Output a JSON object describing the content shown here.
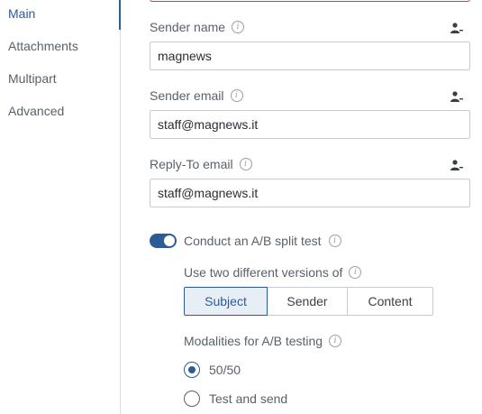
{
  "sidebar": {
    "items": [
      {
        "label": "Main",
        "active": true
      },
      {
        "label": "Attachments",
        "active": false
      },
      {
        "label": "Multipart",
        "active": false
      },
      {
        "label": "Advanced",
        "active": false
      }
    ]
  },
  "form": {
    "sender_name": {
      "label": "Sender name",
      "value": "magnews"
    },
    "sender_email": {
      "label": "Sender email",
      "value": "staff@magnews.it"
    },
    "reply_to": {
      "label": "Reply-To email",
      "value": "staff@magnews.it"
    }
  },
  "ab_test": {
    "toggle_label": "Conduct an A/B split test",
    "enabled": true,
    "versions_label": "Use two different versions of",
    "options": [
      "Subject",
      "Sender",
      "Content"
    ],
    "selected_option": "Subject",
    "modalities_label": "Modalities for A/B testing",
    "modalities": [
      "50/50",
      "Test and send"
    ],
    "selected_modality": "50/50"
  },
  "colors": {
    "accent": "#2f5b95",
    "error_border": "#c73b6b"
  },
  "icons": {
    "info": "info-icon",
    "person": "person-icon"
  }
}
